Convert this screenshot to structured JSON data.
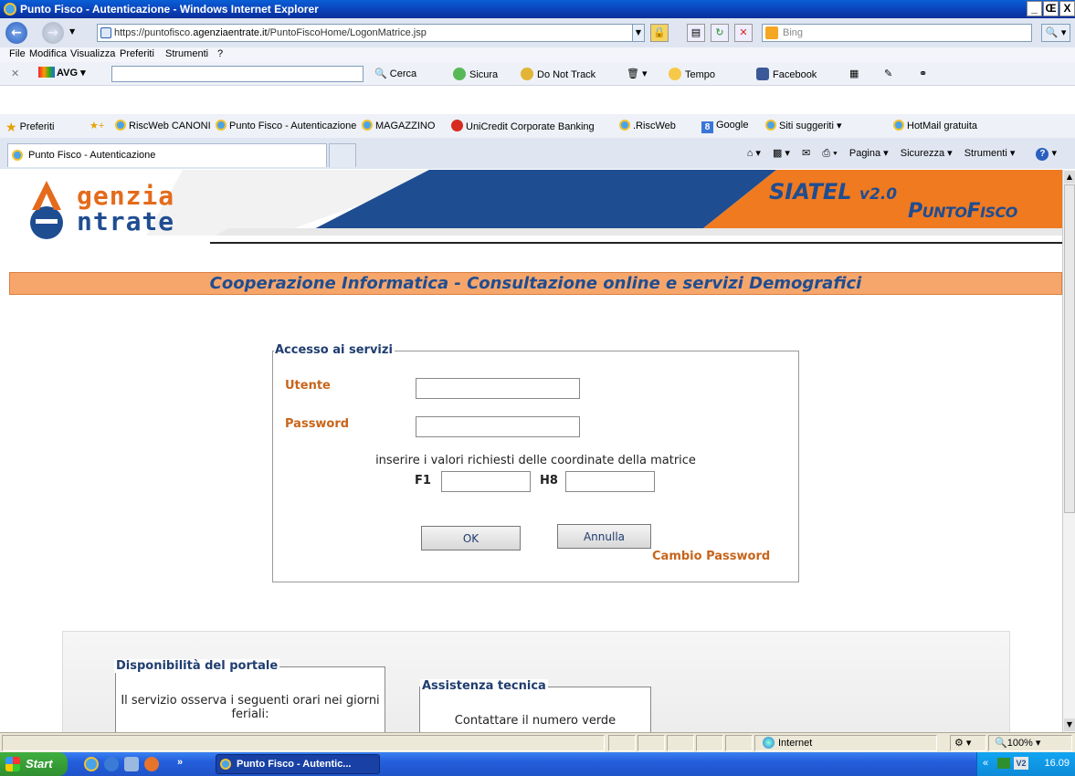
{
  "window": {
    "title": "Punto Fisco - Autenticazione - Windows Internet Explorer",
    "buttons": [
      "_",
      "Œ",
      "X"
    ]
  },
  "address_bar": {
    "url_prefix": "https://puntofisco.",
    "url_domain": "agenziaentrate.it",
    "url_path": "/PuntoFiscoHome/LogonMatrice.jsp",
    "search_placeholder": "Bing"
  },
  "menu": [
    "File",
    "Modifica",
    "Visualizza",
    "Preferiti",
    "Strumenti",
    "?"
  ],
  "avg_toolbar": {
    "brand": "AVG",
    "cerca": "Cerca",
    "sicura": "Sicura",
    "dnt": "Do Not Track",
    "tempo": "Tempo",
    "facebook": "Facebook"
  },
  "favorites": {
    "label": "Preferiti",
    "items": [
      "RiscWeb CANONI",
      "Punto Fisco - Autenticazione",
      "MAGAZZINO",
      "UniCredit Corporate Banking",
      ".RiscWeb",
      "Google",
      "Siti suggeriti ▾",
      "HotMail gratuita"
    ]
  },
  "tab": {
    "label": "Punto Fisco - Autenticazione"
  },
  "command_bar": [
    "Pagina ▾",
    "Sicurezza ▾",
    "Strumenti ▾"
  ],
  "header": {
    "logo_line1": "genzia",
    "logo_line2": "ntrate",
    "siatel": "SIATEL",
    "siatel_version": "v2.0",
    "puntofisco_p": "P",
    "puntofisco_unto": "UNTO",
    "puntofisco_f": "F",
    "puntofisco_isco": "ISCO",
    "subtitle": "Cooperazione Informatica - Consultazione online e servizi Demografici"
  },
  "login": {
    "legend": "Accesso ai servizi",
    "user_label": "Utente",
    "user_value": "",
    "password_label": "Password",
    "password_value": "",
    "instructions": "inserire i valori richiesti delle coordinate della matrice",
    "coord1_label": "F1",
    "coord1_value": "",
    "coord2_label": "H8",
    "coord2_value": "",
    "ok_label": "OK",
    "cancel_label": "Annulla",
    "change_password": "Cambio Password"
  },
  "info": {
    "portal_title": "Disponibilità del portale",
    "portal_text": "Il servizio osserva i seguenti orari nei giorni feriali:",
    "support_title": "Assistenza tecnica",
    "support_text": "Contattare il numero verde"
  },
  "status_bar": {
    "zone": "Internet",
    "zoom": "100%"
  },
  "taskbar": {
    "start": "Start",
    "chevron": "»",
    "task": "Punto Fisco - Autentic...",
    "tray_chevron": "«",
    "time": "16.09"
  }
}
